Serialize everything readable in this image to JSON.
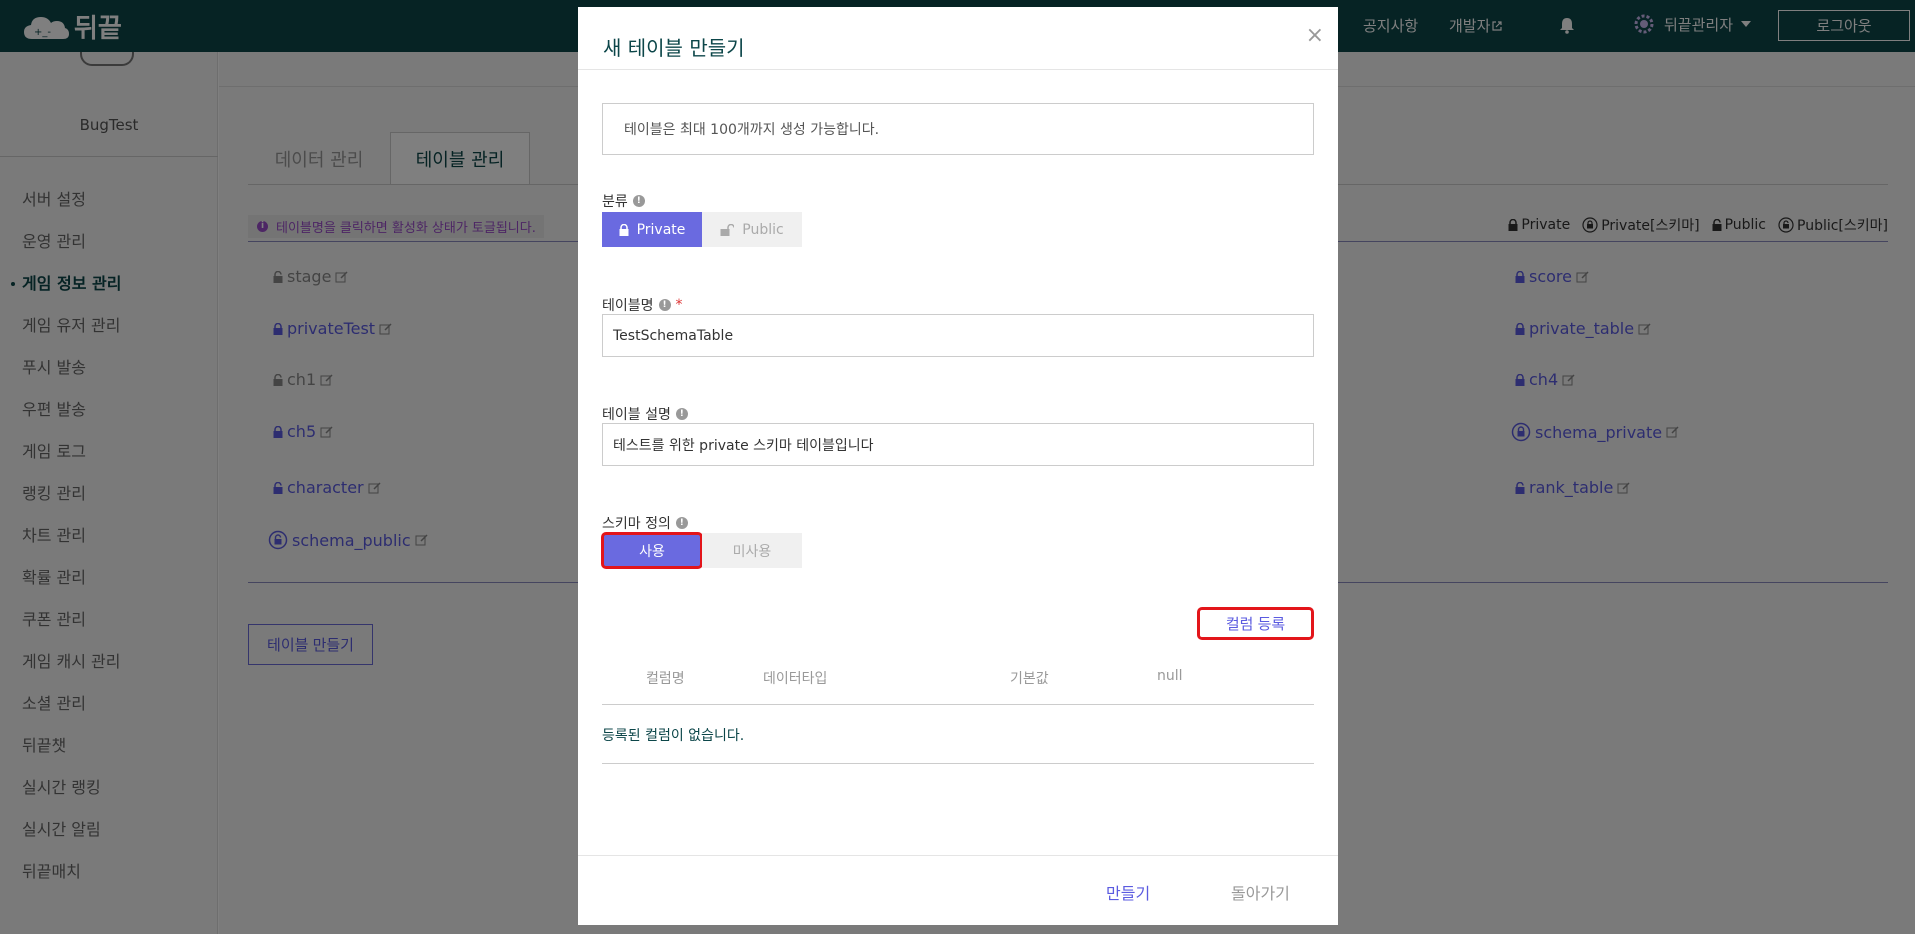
{
  "header": {
    "logo_text": "뒤끝",
    "nav": [
      {
        "label": "공지사항"
      },
      {
        "label": "개발자"
      }
    ],
    "admin_label": "뒤끝관리자",
    "logout_label": "로그아웃"
  },
  "sidebar": {
    "project_name": "BugTest",
    "items": [
      {
        "label": "서버 설정"
      },
      {
        "label": "운영 관리"
      },
      {
        "label": "게임 정보 관리"
      },
      {
        "label": "게임 유저 관리"
      },
      {
        "label": "푸시 발송"
      },
      {
        "label": "우편 발송"
      },
      {
        "label": "게임 로그"
      },
      {
        "label": "랭킹 관리"
      },
      {
        "label": "차트 관리"
      },
      {
        "label": "확률 관리"
      },
      {
        "label": "쿠폰 관리"
      },
      {
        "label": "게임 캐시 관리"
      },
      {
        "label": "소셜 관리"
      },
      {
        "label": "뒤끝챗"
      },
      {
        "label": "실시간 랭킹"
      },
      {
        "label": "실시간 알림"
      },
      {
        "label": "뒤끝매치"
      }
    ],
    "active_index": 2
  },
  "main": {
    "tabs": [
      {
        "label": "데이터 관리"
      },
      {
        "label": "테이블 관리"
      }
    ],
    "notice": "테이블명을 클릭하면 활성화 상태가 토글됩니다.",
    "legend": [
      "Private",
      "Private[스키마]",
      "Public",
      "Public[스키마]"
    ],
    "tables_left": [
      {
        "name": "stage",
        "kind": "public"
      },
      {
        "name": "privateTest",
        "kind": "private"
      },
      {
        "name": "ch1",
        "kind": "public"
      },
      {
        "name": "ch5",
        "kind": "private"
      },
      {
        "name": "character",
        "kind": "private"
      },
      {
        "name": "schema_public",
        "kind": "public-schema"
      }
    ],
    "tables_right": [
      {
        "name": "score",
        "kind": "private"
      },
      {
        "name": "private_table",
        "kind": "private"
      },
      {
        "name": "ch4",
        "kind": "private"
      },
      {
        "name": "schema_private",
        "kind": "private-schema"
      },
      {
        "name": "rank_table",
        "kind": "private"
      }
    ],
    "create_button": "테이블 만들기"
  },
  "modal": {
    "title": "새 테이블 만들기",
    "close": "×",
    "limit_notice": "테이블은 최대 100개까지 생성 가능합니다.",
    "category_label": "분류",
    "category_options": [
      "Private",
      "Public"
    ],
    "table_name_label": "테이블명",
    "required_mark": "*",
    "table_name_value": "TestSchemaTable",
    "desc_label": "테이블 설명",
    "desc_value": "테스트를 위한 private 스키마 테이블입니다",
    "schema_label": "스키마 정의",
    "schema_options": [
      "사용",
      "미사용"
    ],
    "column_register": "컬럼 등록",
    "columns": [
      "컬럼명",
      "데이터타입",
      "기본값",
      "null"
    ],
    "empty_message": "등록된 컬럼이 없습니다.",
    "make_button": "만들기",
    "back_button": "돌아가기"
  },
  "colors": {
    "header_bg": "#0c4649",
    "accent": "#6a6ae0",
    "highlight": "#e3151a"
  }
}
